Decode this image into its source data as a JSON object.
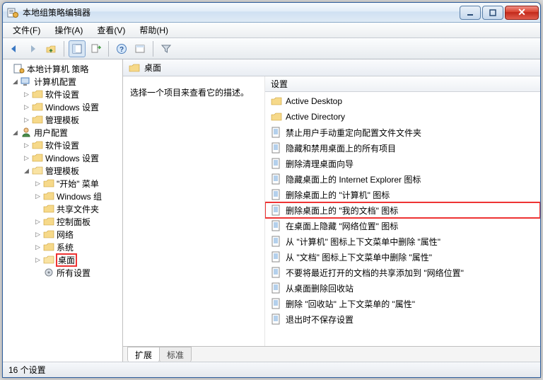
{
  "window": {
    "title": "本地组策略编辑器"
  },
  "menu": {
    "file": "文件(F)",
    "action": "操作(A)",
    "view": "查看(V)",
    "help": "帮助(H)"
  },
  "tree": {
    "root": "本地计算机 策略",
    "computer_config": "计算机配置",
    "software_settings": "软件设置",
    "windows_settings": "Windows 设置",
    "admin_templates": "管理模板",
    "user_config": "用户配置",
    "start_menu": "\"开始\" 菜单",
    "windows_components": "Windows 组",
    "shared_folders": "共享文件夹",
    "control_panel": "控制面板",
    "network": "网络",
    "system": "系统",
    "desktop": "桌面",
    "all_settings": "所有设置"
  },
  "content": {
    "header": "桌面",
    "description_prompt": "选择一个项目来查看它的描述。",
    "settings_header": "设置"
  },
  "settings_list": {
    "folders": [
      "Active Desktop",
      "Active Directory"
    ],
    "policies": [
      "禁止用户手动重定向配置文件文件夹",
      "隐藏和禁用桌面上的所有项目",
      "删除清理桌面向导",
      "隐藏桌面上的 Internet Explorer 图标",
      "删除桌面上的 \"计算机\" 图标",
      "删除桌面上的 \"我的文档\" 图标",
      "在桌面上隐藏 \"网络位置\" 图标",
      "从 \"计算机\" 图标上下文菜单中删除 \"属性\"",
      "从 \"文档\" 图标上下文菜单中删除  \"属性\"",
      "不要将最近打开的文档的共享添加到 \"网络位置\"",
      "从桌面删除回收站",
      "删除 \"回收站\" 上下文菜单的 \"属性\"",
      "退出时不保存设置"
    ]
  },
  "tabs": {
    "extended": "扩展",
    "standard": "标准"
  },
  "status": {
    "count": "16 个设置"
  },
  "highlights": {
    "tree_index": "desktop",
    "list_policy_index": 5
  }
}
